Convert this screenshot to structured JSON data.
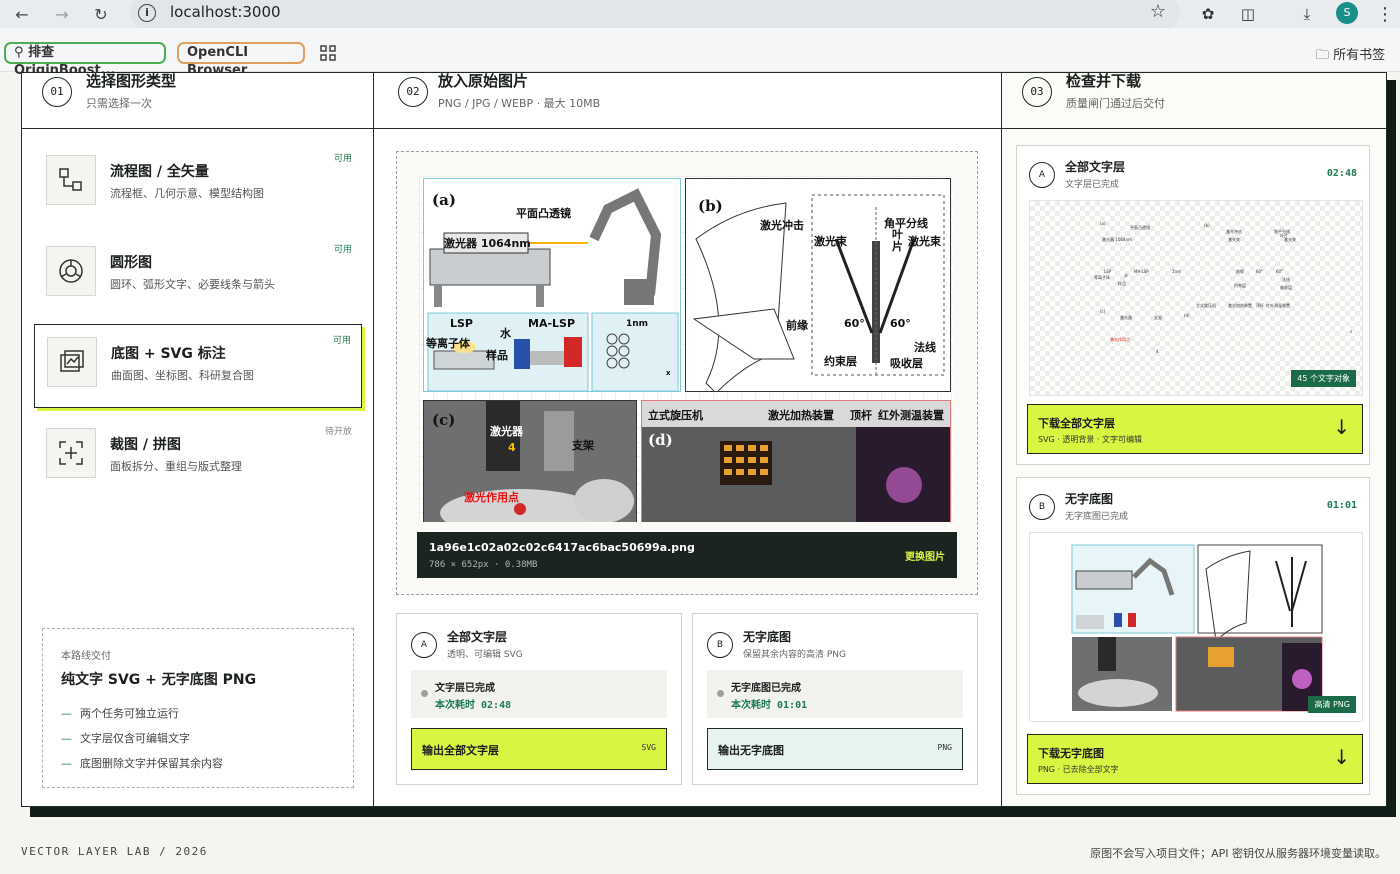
{
  "browser": {
    "url": "localhost:3000",
    "avatar_letter": "S",
    "bookmarks": [
      "排查 OriginBoost...",
      "OpenCLI Browser"
    ],
    "all_bookmarks": "所有书签"
  },
  "steps": [
    {
      "num": "01",
      "title": "选择图形类型",
      "sub": "只需选择一次"
    },
    {
      "num": "02",
      "title": "放入原始图片",
      "sub": "PNG / JPG / WEBP · 最大 10MB"
    },
    {
      "num": "03",
      "title": "检查并下载",
      "sub": "质量闸门通过后交付"
    }
  ],
  "types": [
    {
      "title": "流程图 / 全矢量",
      "sub": "流程框、几何示意、模型结构图",
      "tag": "可用"
    },
    {
      "title": "圆形图",
      "sub": "圆环、弧形文字、必要线条与箭头",
      "tag": "可用"
    },
    {
      "title": "底图 + SVG 标注",
      "sub": "曲面图、坐标图、科研复合图",
      "tag": "可用"
    },
    {
      "title": "裁图 / 拼图",
      "sub": "面板拆分、重组与版式整理",
      "tag": "待开放"
    }
  ],
  "route": {
    "label": "本路线交付",
    "title": "纯文字 SVG + 无字底图 PNG",
    "items": [
      "两个任务可独立运行",
      "文字层仅含可编辑文字",
      "底图删除文字并保留其余内容"
    ]
  },
  "figure": {
    "labels": {
      "a": "(a)",
      "b": "(b)",
      "c": "(c)",
      "d": "(d)"
    },
    "a": {
      "lens": "平面凸透镜",
      "laser": "激光器 1064nm",
      "lsp": "LSP",
      "malsp": "MA-LSP",
      "plasma": "等离子体",
      "water": "水",
      "sample": "样品",
      "scale": "1nm",
      "x": "x"
    },
    "b": {
      "shock": "激光冲击",
      "beam_l": "激光束",
      "bisector": "角平分线",
      "blade": "叶片",
      "beam_r": "激光束",
      "edge": "前缘",
      "angle_l": "60°",
      "angle_r": "60°",
      "normal": "法线",
      "constraint": "约束层",
      "absorb": "吸收层"
    },
    "c": {
      "laser": "激光器",
      "num": "4",
      "bracket": "支架",
      "point": "激光作用点"
    },
    "d": {
      "lathe": "立式旋压机",
      "heater": "激光加热装置",
      "rod": "顶杆",
      "ir": "红外测温装置"
    }
  },
  "file": {
    "name": "1a96e1c02a02c02c6417ac6bac50699a.png",
    "meta": "786 × 652px · 0.38MB",
    "replace": "更换图片"
  },
  "outputs": [
    {
      "letter": "A",
      "title": "全部文字层",
      "sub": "透明、可编辑 SVG",
      "status": "文字层已完成",
      "time": "本次耗时  02:48",
      "button": "输出全部文字层",
      "format": "SVG"
    },
    {
      "letter": "B",
      "title": "无字底图",
      "sub": "保留其余内容的高清 PNG",
      "status": "无字底图已完成",
      "time": "本次耗时  01:01",
      "button": "输出无字底图",
      "format": "PNG"
    }
  ],
  "results": [
    {
      "letter": "A",
      "title": "全部文字层",
      "sub": "文字层已完成",
      "time": "02:48",
      "badge": "45 个文字对象",
      "button": "下载全部文字层",
      "button_sub": "SVG · 透明背景 · 文字可编辑"
    },
    {
      "letter": "B",
      "title": "无字底图",
      "sub": "无字底图已完成",
      "time": "01:01",
      "badge": "高清 PNG",
      "button": "下载无字底图",
      "button_sub": "PNG · 已去除全部文字"
    }
  ],
  "text_layer_preview": [
    "(a)",
    "平面凸透镜",
    "激光器 1064nm",
    "(b)",
    "激光冲击",
    "激光束",
    "角平分线",
    "叶片",
    "激光束",
    "LSP",
    "MA-LSP",
    "等离子体",
    "水",
    "样品",
    "1nm",
    "前缘",
    "60°",
    "60°",
    "法线",
    "约束层",
    "吸收层",
    "(c)",
    "激光器",
    "支架",
    "(d)",
    "立式旋压机",
    "激光加热装置",
    "顶杆",
    "红外测温装置",
    "激光作用点",
    "4",
    "x"
  ],
  "footer": {
    "left": "VECTOR LAYER LAB / 2026",
    "right": "原图不会写入项目文件；API 密钥仅从服务器环境变量读取。"
  },
  "colors": {
    "accent": "#d9f542",
    "ink": "#1e2a23",
    "green": "#1f7a53"
  }
}
